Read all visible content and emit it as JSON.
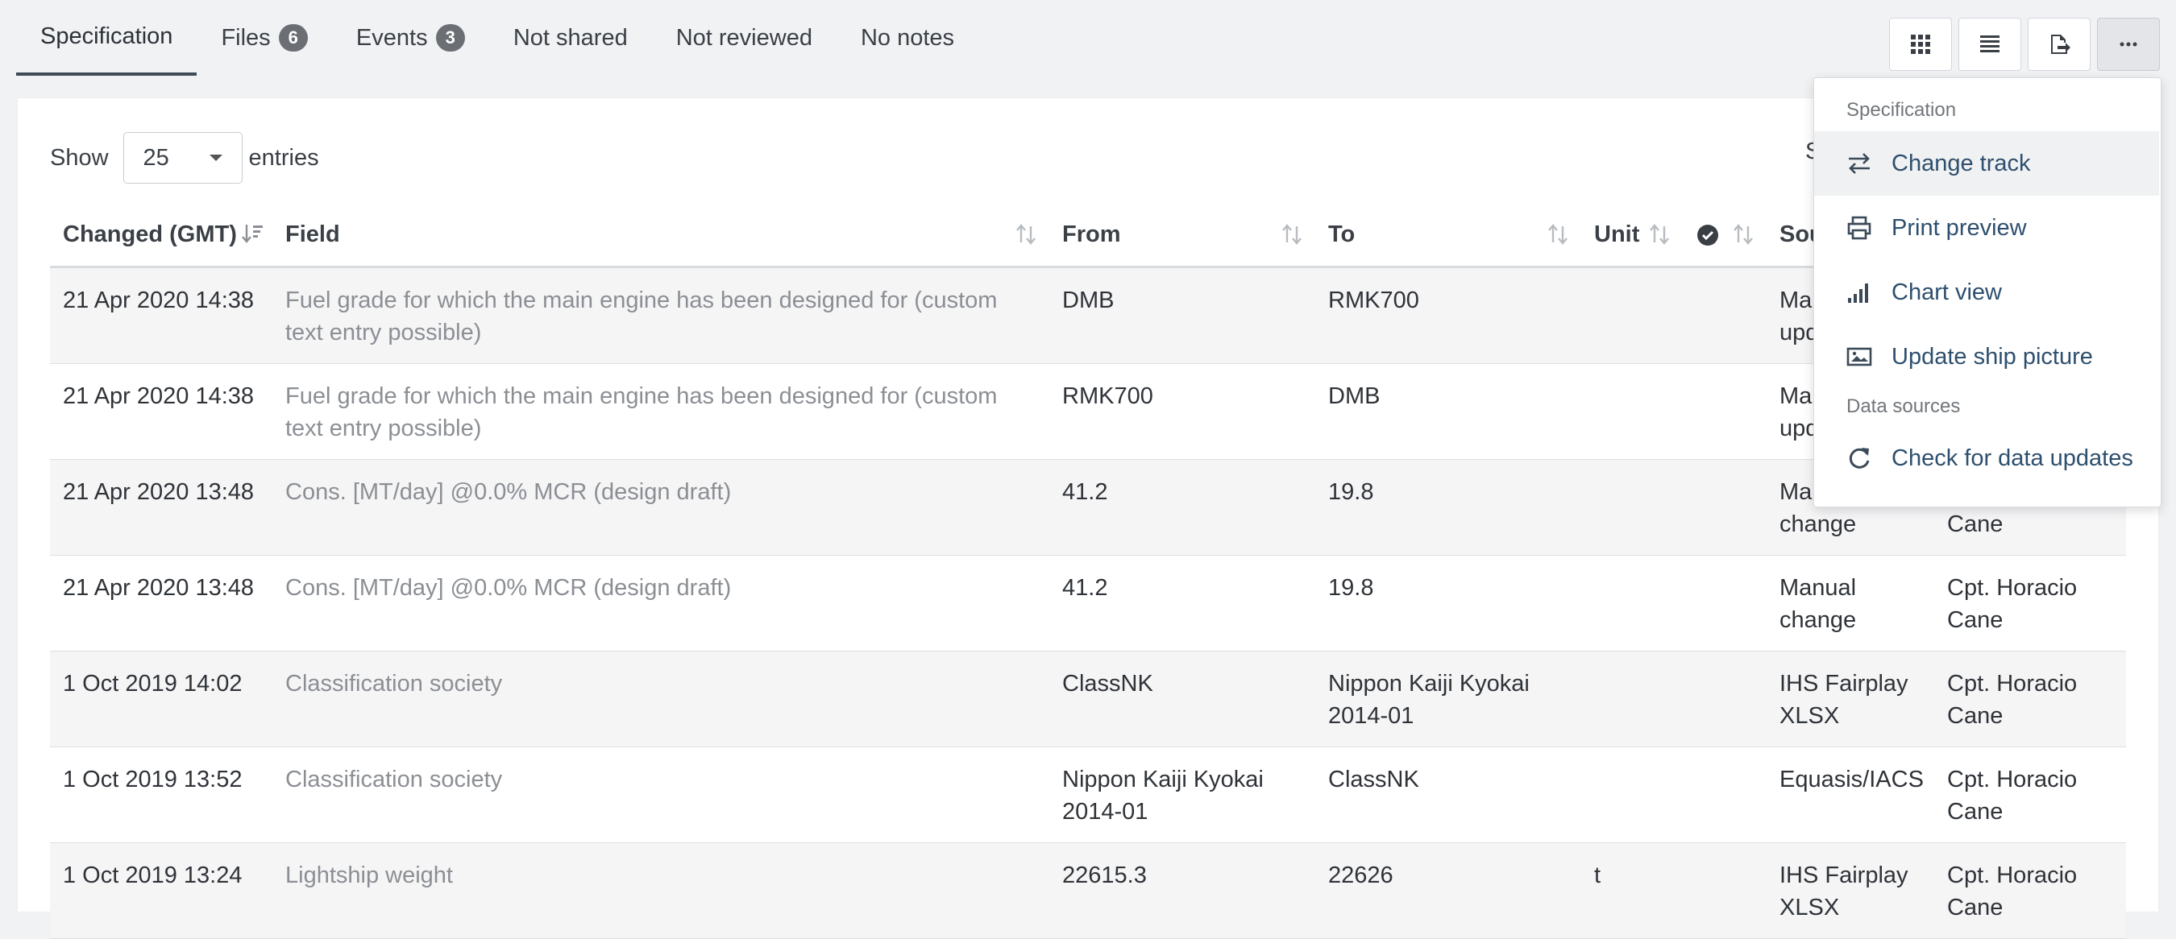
{
  "tabs": [
    {
      "label": "Specification"
    },
    {
      "label": "Files",
      "badge": "6"
    },
    {
      "label": "Events",
      "badge": "3"
    },
    {
      "label": "Not shared"
    },
    {
      "label": "Not reviewed"
    },
    {
      "label": "No notes"
    }
  ],
  "toolbar": {
    "icons": [
      "grid-icon",
      "list-icon",
      "export-icon",
      "more-icon"
    ]
  },
  "length": {
    "show_label": "Show",
    "value": "25",
    "entries_label": "entries"
  },
  "search": {
    "label_partial": "S"
  },
  "table": {
    "headers": {
      "changed": "Changed (GMT)",
      "field": "Field",
      "from": "From",
      "to": "To",
      "unit": "Unit",
      "source": "Sou",
      "user": ""
    },
    "rows": [
      {
        "changed": "21 Apr 2020 14:38",
        "field": "Fuel grade for which the main engine has been designed for (custom text entry possible)",
        "from": "DMB",
        "to": "RMK700",
        "unit": "",
        "source": "Manual update",
        "user": ""
      },
      {
        "changed": "21 Apr 2020 14:38",
        "field": "Fuel grade for which the main engine has been designed for (custom text entry possible)",
        "from": "RMK700",
        "to": "DMB",
        "unit": "",
        "source": "Manual update",
        "user": ""
      },
      {
        "changed": "21 Apr 2020 13:48",
        "field": "Cons. [MT/day] @0.0% MCR (design draft)",
        "from": "41.2",
        "to": "19.8",
        "unit": "",
        "source": "Manual change",
        "user": "Cpt. Horacio Cane"
      },
      {
        "changed": "21 Apr 2020 13:48",
        "field": "Cons. [MT/day] @0.0% MCR (design draft)",
        "from": "41.2",
        "to": "19.8",
        "unit": "",
        "source": "Manual change",
        "user": "Cpt. Horacio Cane"
      },
      {
        "changed": "1 Oct 2019 14:02",
        "field": "Classification society",
        "from": "ClassNK",
        "to": "Nippon Kaiji Kyokai 2014-01",
        "unit": "",
        "source": "IHS Fairplay XLSX",
        "user": "Cpt. Horacio Cane"
      },
      {
        "changed": "1 Oct 2019 13:52",
        "field": "Classification society",
        "from": "Nippon Kaiji Kyokai 2014-01",
        "to": "ClassNK",
        "unit": "",
        "source": "Equasis/IACS",
        "user": "Cpt. Horacio Cane"
      },
      {
        "changed": "1 Oct 2019 13:24",
        "field": "Lightship weight",
        "from": "22615.3",
        "to": "22626",
        "unit": "t",
        "source": "IHS Fairplay XLSX",
        "user": "Cpt. Horacio Cane"
      }
    ]
  },
  "menu": {
    "section1": "Specification",
    "items1": [
      {
        "label": "Change track",
        "icon": "swap-icon"
      },
      {
        "label": "Print preview",
        "icon": "printer-icon"
      },
      {
        "label": "Chart view",
        "icon": "signal-bars-icon"
      },
      {
        "label": "Update ship picture",
        "icon": "image-icon"
      }
    ],
    "section2": "Data sources",
    "items2": [
      {
        "label": "Check for data updates",
        "icon": "refresh-icon"
      }
    ]
  },
  "colors": {
    "menu_link": "#2e4f6e",
    "badge": "#6b6f74",
    "active_tab_border": "#3e4a55"
  }
}
